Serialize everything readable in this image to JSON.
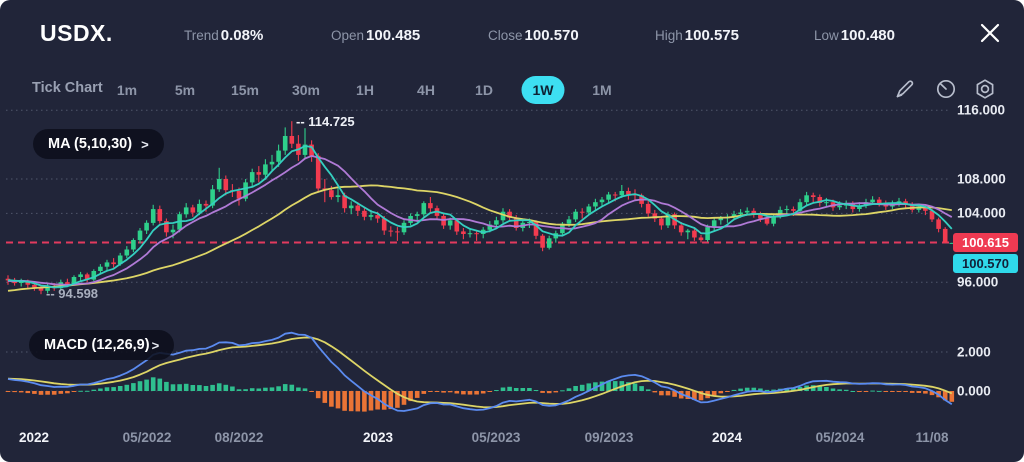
{
  "header": {
    "symbol": "USDX.",
    "stats": [
      {
        "label": "Trend",
        "value": "0.08%"
      },
      {
        "label": "Open",
        "value": "100.485"
      },
      {
        "label": "Close",
        "value": "100.570"
      },
      {
        "label": "High",
        "value": "100.575"
      },
      {
        "label": "Low",
        "value": "100.480"
      }
    ]
  },
  "toolbar": {
    "tick_chart": "Tick Chart",
    "timeframes": [
      "1m",
      "5m",
      "15m",
      "30m",
      "1H",
      "4H",
      "1D",
      "1W",
      "1M"
    ],
    "active": "1W",
    "icons": [
      "draw-icon",
      "history-icon",
      "settings-icon"
    ]
  },
  "indicators": {
    "ma_label": "MA (5,10,30)",
    "macd_label": "MACD (12,26,9)",
    "chev": ">"
  },
  "annotations": {
    "high": "-- 114.725",
    "low": "-- 94.598"
  },
  "badges": {
    "price_line": "100.615",
    "last_close": "100.570"
  },
  "colors": {
    "background": "#212539",
    "up": "#2ed08b",
    "down": "#f23b4f",
    "ma5": "#35cfc0",
    "ma10": "#b07ad6",
    "ma30": "#ddd566",
    "macd_line": "#5b8bf0",
    "signal_line": "#ddd566",
    "hist_up": "#2fbf8f",
    "hist_down": "#ea7436",
    "accent": "#3ddff2",
    "price_line": "#e23a5e",
    "badge_red": "#ef3a52",
    "badge_cyan": "#2fd9ea",
    "grid": "rgba(170,178,200,0.35)",
    "text_dim": "#8d95a8",
    "text_bright": "#f2f4f9"
  },
  "chart_data": {
    "type": "candlestick",
    "title": "USDX weekly candlestick with MA(5,10,30) overlay and MACD(12,26,9) subchart",
    "price_axis_labels": [
      {
        "text": "116.000",
        "price": 116
      },
      {
        "text": "108.000",
        "price": 108
      },
      {
        "text": "104.000",
        "price": 104
      },
      {
        "text": "96.000",
        "price": 96
      }
    ],
    "price_gridlines": [
      116,
      108,
      104,
      96
    ],
    "price_line_level": 100.615,
    "last_close": 100.57,
    "high_marker": {
      "index": 43,
      "value": 114.725
    },
    "low_marker": {
      "index": 5,
      "value": 94.598
    },
    "macd_axis_labels": [
      {
        "text": "2.000",
        "value": 2
      },
      {
        "text": "0.000",
        "value": 0
      }
    ],
    "macd_params": [
      12,
      26,
      9
    ],
    "ma_periods": [
      5,
      10,
      30
    ],
    "time_axis": [
      {
        "label": "2022",
        "i": 4,
        "bold": true
      },
      {
        "label": "05/2022",
        "i": 21,
        "bold": false
      },
      {
        "label": "08/2022",
        "i": 35,
        "bold": false
      },
      {
        "label": "2023",
        "i": 56,
        "bold": true
      },
      {
        "label": "05/2023",
        "i": 74,
        "bold": false
      },
      {
        "label": "09/2023",
        "i": 91,
        "bold": false
      },
      {
        "label": "2024",
        "i": 109,
        "bold": true
      },
      {
        "label": "05/2024",
        "i": 126,
        "bold": false
      },
      {
        "label": "11/08",
        "i": 140,
        "bold": false
      }
    ],
    "history_closes": [
      93.1,
      93.3,
      93.0,
      93.4,
      93.6,
      93.4,
      93.8,
      94.0,
      93.8,
      94.1,
      94.4,
      94.3,
      94.6,
      94.9,
      94.8,
      95.1,
      95.4,
      95.3,
      95.6,
      95.9,
      95.7,
      96.0,
      95.8,
      96.1,
      96.3,
      96.0,
      96.2,
      96.4,
      96.1,
      96.3
    ],
    "candles": [
      [
        96.4,
        96.8,
        95.7,
        96.2
      ],
      [
        96.2,
        96.5,
        95.6,
        95.9
      ],
      [
        95.9,
        96.4,
        95.5,
        96.1
      ],
      [
        96.1,
        96.3,
        95.3,
        95.7
      ],
      [
        95.7,
        96.0,
        95.0,
        95.4
      ],
      [
        95.4,
        95.6,
        94.598,
        95.0
      ],
      [
        95.0,
        95.8,
        94.7,
        95.5
      ],
      [
        95.5,
        95.9,
        95.0,
        95.3
      ],
      [
        95.3,
        96.3,
        95.1,
        96.0
      ],
      [
        96.0,
        96.4,
        95.5,
        95.8
      ],
      [
        95.8,
        96.8,
        95.6,
        96.6
      ],
      [
        96.6,
        97.2,
        96.2,
        96.9
      ],
      [
        96.9,
        97.1,
        96.0,
        96.3
      ],
      [
        96.3,
        97.5,
        96.1,
        97.3
      ],
      [
        97.3,
        98.1,
        96.9,
        97.8
      ],
      [
        97.8,
        98.6,
        97.4,
        98.3
      ],
      [
        98.3,
        98.8,
        97.7,
        98.1
      ],
      [
        98.1,
        99.4,
        97.9,
        99.1
      ],
      [
        99.1,
        100.2,
        98.8,
        99.8
      ],
      [
        99.8,
        101.1,
        99.5,
        100.9
      ],
      [
        100.9,
        102.3,
        100.5,
        102.0
      ],
      [
        102.0,
        103.2,
        101.6,
        102.9
      ],
      [
        102.9,
        105.0,
        102.6,
        104.5
      ],
      [
        104.5,
        104.9,
        102.8,
        103.1
      ],
      [
        103.1,
        103.4,
        101.3,
        101.8
      ],
      [
        101.8,
        102.7,
        101.1,
        102.1
      ],
      [
        102.1,
        104.2,
        101.8,
        103.9
      ],
      [
        103.9,
        105.2,
        103.5,
        104.7
      ],
      [
        104.7,
        105.0,
        103.6,
        104.1
      ],
      [
        104.1,
        105.6,
        103.8,
        105.1
      ],
      [
        105.1,
        105.5,
        104.2,
        104.9
      ],
      [
        104.9,
        107.3,
        104.6,
        106.8
      ],
      [
        106.8,
        109.3,
        106.5,
        108.0
      ],
      [
        108.0,
        108.4,
        106.1,
        106.7
      ],
      [
        106.7,
        107.4,
        105.9,
        106.6
      ],
      [
        106.6,
        107.0,
        104.9,
        105.7
      ],
      [
        105.7,
        108.0,
        105.4,
        107.6
      ],
      [
        107.6,
        109.2,
        107.1,
        108.8
      ],
      [
        108.8,
        109.5,
        107.6,
        108.5
      ],
      [
        108.5,
        110.3,
        107.9,
        109.7
      ],
      [
        109.7,
        110.8,
        109.0,
        110.0
      ],
      [
        110.0,
        112.0,
        109.4,
        111.3
      ],
      [
        111.3,
        114.0,
        110.8,
        113.0
      ],
      [
        113.0,
        114.725,
        111.6,
        112.1
      ],
      [
        112.1,
        113.1,
        110.1,
        110.8
      ],
      [
        110.8,
        113.9,
        110.3,
        112.0
      ],
      [
        112.0,
        112.5,
        110.0,
        110.7
      ],
      [
        110.7,
        111.0,
        106.4,
        106.9
      ],
      [
        106.9,
        108.0,
        105.3,
        106.7
      ],
      [
        106.7,
        107.2,
        105.6,
        105.9
      ],
      [
        105.9,
        107.0,
        105.3,
        106.1
      ],
      [
        106.1,
        106.4,
        104.1,
        104.6
      ],
      [
        104.6,
        105.4,
        103.9,
        104.9
      ],
      [
        104.9,
        105.3,
        103.7,
        104.3
      ],
      [
        104.3,
        104.7,
        103.2,
        103.6
      ],
      [
        103.6,
        104.4,
        103.2,
        103.8
      ],
      [
        103.8,
        104.2,
        102.9,
        103.4
      ],
      [
        103.4,
        103.7,
        101.5,
        102.0
      ],
      [
        102.0,
        102.5,
        101.3,
        101.9
      ],
      [
        101.9,
        102.4,
        100.8,
        101.8
      ],
      [
        101.8,
        103.2,
        101.5,
        102.9
      ],
      [
        102.9,
        104.0,
        102.6,
        103.7
      ],
      [
        103.7,
        104.2,
        103.0,
        103.9
      ],
      [
        103.9,
        105.4,
        103.6,
        105.2
      ],
      [
        105.2,
        105.9,
        104.1,
        104.6
      ],
      [
        104.6,
        104.9,
        103.3,
        103.7
      ],
      [
        103.7,
        104.1,
        102.2,
        102.6
      ],
      [
        102.6,
        103.5,
        102.1,
        103.2
      ],
      [
        103.2,
        103.4,
        101.5,
        101.9
      ],
      [
        101.9,
        102.3,
        101.0,
        101.6
      ],
      [
        101.6,
        102.2,
        101.2,
        101.7
      ],
      [
        101.7,
        102.0,
        100.8,
        101.6
      ],
      [
        101.6,
        102.4,
        101.1,
        102.1
      ],
      [
        102.1,
        103.1,
        101.8,
        102.7
      ],
      [
        102.7,
        103.6,
        102.3,
        103.2
      ],
      [
        103.2,
        104.6,
        102.9,
        104.2
      ],
      [
        104.2,
        104.5,
        103.1,
        103.5
      ],
      [
        103.5,
        103.8,
        102.0,
        102.3
      ],
      [
        102.3,
        103.3,
        101.9,
        102.9
      ],
      [
        102.9,
        103.4,
        102.3,
        103.0
      ],
      [
        103.0,
        103.2,
        101.0,
        101.4
      ],
      [
        101.4,
        101.6,
        99.6,
        100.0
      ],
      [
        100.0,
        101.4,
        99.8,
        101.1
      ],
      [
        101.1,
        102.0,
        100.6,
        101.7
      ],
      [
        101.7,
        103.0,
        101.4,
        102.8
      ],
      [
        102.8,
        103.7,
        102.4,
        103.3
      ],
      [
        103.3,
        104.5,
        103.0,
        104.2
      ],
      [
        104.2,
        104.6,
        103.4,
        104.1
      ],
      [
        104.1,
        105.1,
        103.8,
        104.8
      ],
      [
        104.8,
        105.7,
        104.4,
        105.3
      ],
      [
        105.3,
        105.9,
        104.8,
        105.6
      ],
      [
        105.6,
        106.5,
        105.2,
        106.2
      ],
      [
        106.2,
        106.5,
        105.4,
        106.1
      ],
      [
        106.1,
        107.3,
        105.8,
        106.6
      ],
      [
        106.6,
        107.0,
        105.6,
        106.2
      ],
      [
        106.2,
        106.8,
        105.5,
        106.1
      ],
      [
        106.1,
        106.3,
        104.7,
        105.1
      ],
      [
        105.1,
        105.5,
        103.6,
        104.0
      ],
      [
        104.0,
        104.4,
        103.0,
        103.4
      ],
      [
        103.4,
        103.7,
        102.1,
        102.6
      ],
      [
        102.6,
        104.2,
        102.3,
        103.9
      ],
      [
        103.9,
        104.1,
        102.2,
        102.6
      ],
      [
        102.6,
        103.0,
        101.4,
        101.8
      ],
      [
        101.8,
        102.2,
        101.0,
        102.0
      ],
      [
        102.0,
        102.3,
        100.8,
        101.2
      ],
      [
        101.2,
        101.5,
        100.62,
        100.9
      ],
      [
        100.9,
        102.7,
        100.7,
        102.4
      ],
      [
        102.4,
        103.5,
        102.0,
        103.2
      ],
      [
        103.2,
        103.7,
        102.7,
        103.4
      ],
      [
        103.4,
        103.9,
        102.9,
        103.6
      ],
      [
        103.6,
        104.3,
        103.2,
        103.9
      ],
      [
        103.9,
        104.5,
        103.5,
        104.1
      ],
      [
        104.1,
        104.7,
        103.8,
        104.3
      ],
      [
        104.3,
        104.6,
        103.5,
        103.9
      ],
      [
        103.9,
        104.2,
        103.0,
        103.4
      ],
      [
        103.4,
        103.8,
        102.6,
        102.8
      ],
      [
        102.8,
        104.0,
        102.5,
        103.7
      ],
      [
        103.7,
        104.8,
        103.4,
        104.4
      ],
      [
        104.4,
        104.9,
        103.9,
        104.5
      ],
      [
        104.5,
        104.8,
        103.7,
        104.3
      ],
      [
        104.3,
        105.7,
        104.0,
        105.3
      ],
      [
        105.3,
        106.5,
        104.9,
        106.1
      ],
      [
        106.1,
        106.4,
        105.3,
        105.9
      ],
      [
        105.9,
        106.2,
        104.8,
        105.2
      ],
      [
        105.2,
        105.8,
        104.7,
        105.3
      ],
      [
        105.3,
        105.6,
        104.3,
        104.7
      ],
      [
        104.7,
        105.4,
        104.4,
        104.9
      ],
      [
        104.9,
        105.5,
        104.5,
        105.1
      ],
      [
        105.1,
        105.4,
        104.1,
        104.5
      ],
      [
        104.5,
        105.3,
        104.2,
        104.9
      ],
      [
        104.9,
        105.7,
        104.6,
        105.3
      ],
      [
        105.3,
        106.0,
        105.0,
        105.6
      ],
      [
        105.6,
        105.9,
        104.8,
        105.2
      ],
      [
        105.2,
        105.5,
        104.4,
        104.8
      ],
      [
        104.8,
        105.5,
        104.5,
        105.1
      ],
      [
        105.1,
        105.8,
        104.8,
        105.4
      ],
      [
        105.4,
        105.7,
        104.6,
        105.0
      ],
      [
        105.0,
        105.3,
        104.1,
        104.4
      ],
      [
        104.4,
        105.1,
        104.1,
        104.8
      ],
      [
        104.8,
        105.0,
        103.8,
        104.3
      ],
      [
        104.3,
        104.5,
        103.0,
        103.3
      ],
      [
        103.3,
        103.5,
        101.8,
        102.2
      ],
      [
        102.2,
        102.4,
        100.5,
        100.615
      ],
      [
        100.485,
        100.575,
        100.48,
        100.57
      ]
    ]
  }
}
